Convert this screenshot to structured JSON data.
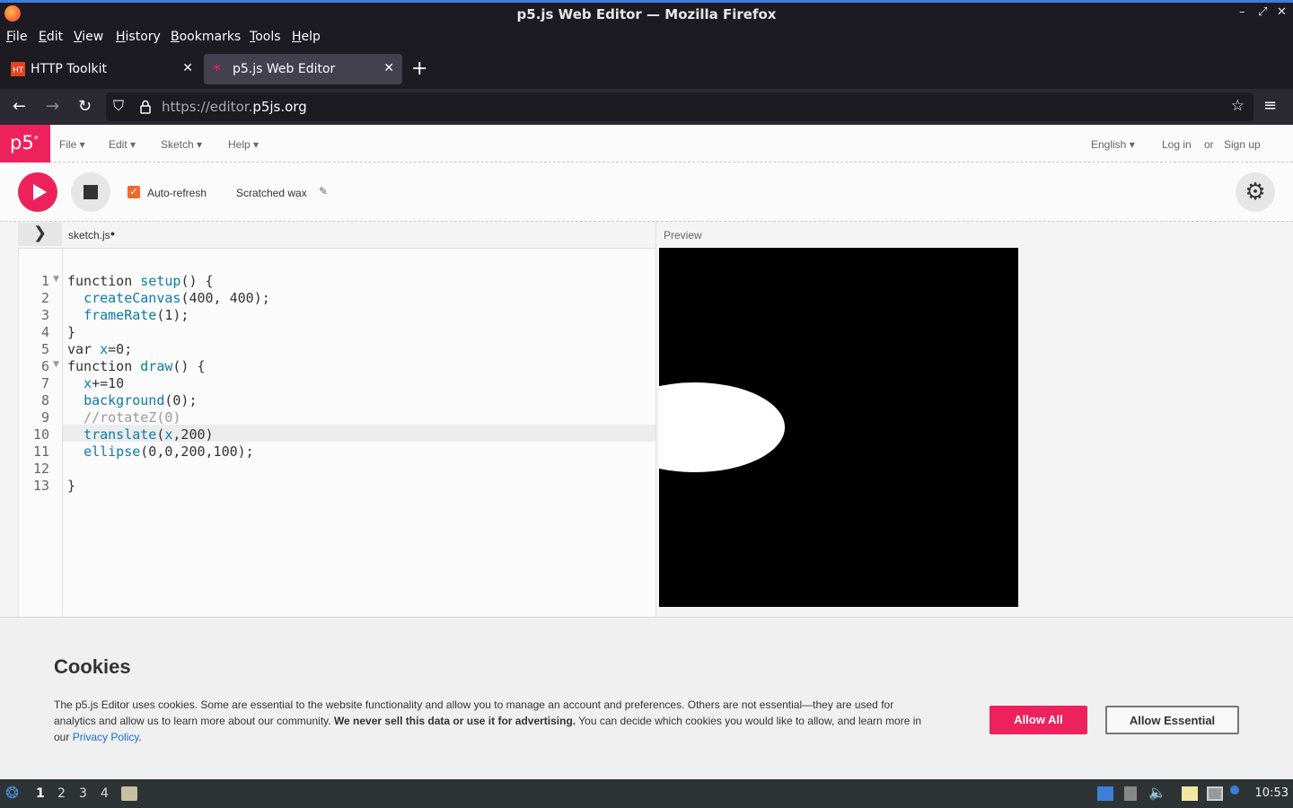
{
  "window": {
    "title": "p5.js Web Editor — Mozilla Firefox"
  },
  "menubar": [
    "File",
    "Edit",
    "View",
    "History",
    "Bookmarks",
    "Tools",
    "Help"
  ],
  "tabs": [
    {
      "label": "HTTP Toolkit"
    },
    {
      "label": "p5.js Web Editor"
    }
  ],
  "urlbar": {
    "prefix": "https://editor.",
    "domain": "p5js.org"
  },
  "p5": {
    "logo": "p5",
    "logo_sup": "*",
    "menus": [
      "File",
      "Edit",
      "Sketch",
      "Help"
    ],
    "language": "English",
    "login": "Log in",
    "or": "or",
    "signup": "Sign up",
    "autorefresh_label": "Auto-refresh",
    "sketch_name": "Scratched wax",
    "file_tab": "sketch.js",
    "preview_label": "Preview"
  },
  "code": {
    "line_numbers": [
      "1",
      "2",
      "3",
      "4",
      "5",
      "6",
      "7",
      "8",
      "9",
      "10",
      "11",
      "12",
      "13"
    ]
  },
  "cookie": {
    "title": "Cookies",
    "text_a": "The p5.js Editor uses cookies. Some are essential to the website functionality and allow you to manage an account and preferences. Others are not essential—they are used for analytics and allow us to learn more about our community. ",
    "text_bold": "We never sell this data or use it for advertising.",
    "text_b": " You can decide which cookies you would like to allow, and learn more in our ",
    "link": "Privacy Policy",
    "text_end": ".",
    "allow_all": "Allow All",
    "allow_essential": "Allow Essential"
  },
  "taskbar": {
    "workspaces": [
      "1",
      "2",
      "3",
      "4"
    ],
    "clock": "10:53"
  },
  "colors": {
    "accent": "#ed225d",
    "checkbox": "#ed6a2d",
    "code_function": "#0b7ca9"
  }
}
